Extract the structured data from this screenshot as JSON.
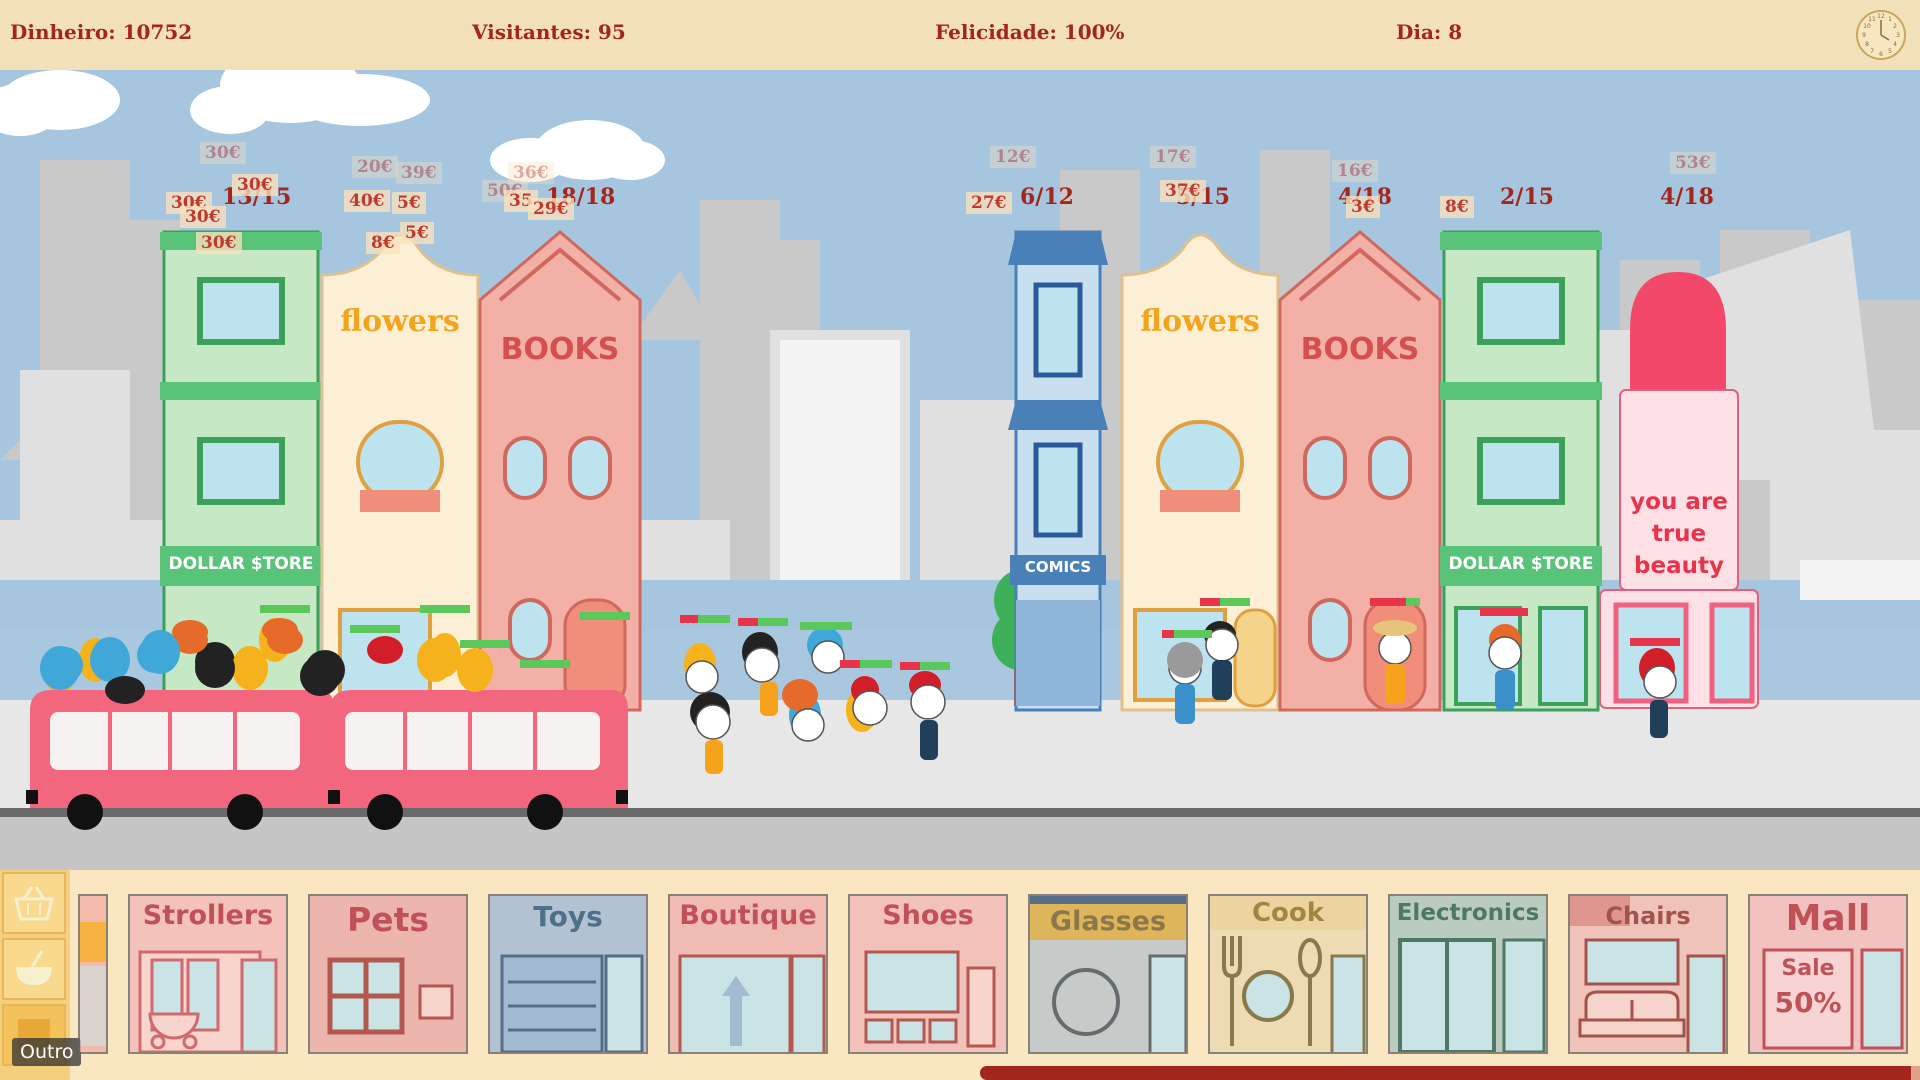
{
  "hud": {
    "money": "Dinheiro: 10752",
    "visitors": "Visitantes: 95",
    "happiness": "Felicidade: 100%",
    "day": "Dia: 8"
  },
  "shops": [
    {
      "name": "dollar-store",
      "sign": "DOLLAR $TORE",
      "capacity": "13/15"
    },
    {
      "name": "flowers",
      "sign": "flowers",
      "capacity": ""
    },
    {
      "name": "books",
      "sign": "BOOKS",
      "capacity": "18/18"
    },
    {
      "name": "comics",
      "sign": "COMICS",
      "capacity": "6/12"
    },
    {
      "name": "flowers-2",
      "sign": "flowers",
      "capacity": "5/15"
    },
    {
      "name": "books-2",
      "sign": "BOOKS",
      "capacity": "4/18"
    },
    {
      "name": "dollar-store-2",
      "sign": "DOLLAR $TORE",
      "capacity": "2/15"
    },
    {
      "name": "beauty",
      "sign_lines": [
        "you are",
        "true",
        "beauty"
      ],
      "capacity": "4/18"
    }
  ],
  "prices": {
    "p1": "30€",
    "p2": "30€",
    "p3": "30€",
    "p4": "30€",
    "p5": "30€",
    "p6": "20€",
    "p7": "39€",
    "p8": "40€",
    "p9": "5€",
    "p10": "5€",
    "p11": "8€",
    "p12": "36€",
    "p13": "50€",
    "p14": "35",
    "p15": "29€",
    "p16": "12€",
    "p17": "27€",
    "p18": "17€",
    "p19": "37€",
    "p20": "16€",
    "p21": "3€",
    "p22": "8€",
    "p23": "53€"
  },
  "shop_bar": {
    "category": "Outro",
    "cards": [
      {
        "label": "Strollers",
        "color": "#b0283a"
      },
      {
        "label": "Pets",
        "color": "#b0283a"
      },
      {
        "label": "Toys",
        "color": "#1f4f7a"
      },
      {
        "label": "Boutique",
        "color": "#b0283a"
      },
      {
        "label": "Shoes",
        "color": "#b0283a"
      },
      {
        "label": "Glasses",
        "color": "#6b5a2a"
      },
      {
        "label": "Cook",
        "color": "#8a6a1f"
      },
      {
        "label": "Electronics",
        "color": "#1f5a4a"
      },
      {
        "label": "Chairs",
        "color": "#8a2a2a"
      },
      {
        "label": "Mall",
        "color": "#b0283a"
      }
    ],
    "mall_sale": "Sale",
    "mall_discount": "50%",
    "progress": 0.99
  },
  "colors": {
    "money": "#a3261c",
    "hud_bg": "#f2e0b8",
    "bus": "#f2667e"
  }
}
